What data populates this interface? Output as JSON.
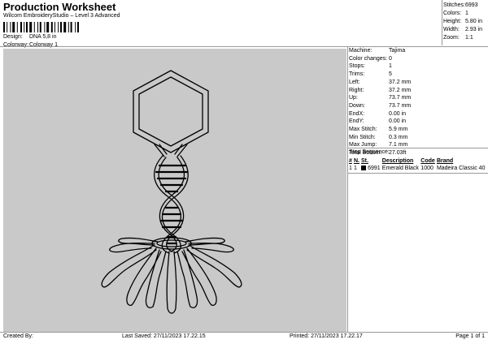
{
  "header": {
    "title": "Production Worksheet",
    "subtitle": "Wilcom EmbroideryStudio – Level 3 Advanced"
  },
  "design_info": {
    "design_label": "Design:",
    "design_value": "DNA 5,8 in",
    "colorway_label": "Colorway:",
    "colorway_value": "Colorway 1"
  },
  "stats": {
    "stitches_label": "Stitches:",
    "stitches": "6993",
    "colors_label": "Colors:",
    "colors": "1",
    "height_label": "Height:",
    "height": "5.80 in",
    "width_label": "Width:",
    "width": "2.93 in",
    "zoom_label": "Zoom:",
    "zoom": "1:1"
  },
  "machine_info": [
    {
      "label": "Machine:",
      "value": "Tajima"
    },
    {
      "label": "Color changes:",
      "value": "0"
    },
    {
      "label": "Stops:",
      "value": "1"
    },
    {
      "label": "Trims:",
      "value": "5"
    },
    {
      "label": "Left:",
      "value": "37.2 mm"
    },
    {
      "label": "Right:",
      "value": "37.2 mm"
    },
    {
      "label": "Up:",
      "value": "73.7 mm"
    },
    {
      "label": "Down:",
      "value": "73.7 mm"
    },
    {
      "label": "EndX:",
      "value": "0.00 in"
    },
    {
      "label": "EndY:",
      "value": "0.00 in"
    },
    {
      "label": "Max Stitch:",
      "value": "5.9 mm"
    },
    {
      "label": "Min Stitch:",
      "value": "0.3 mm"
    },
    {
      "label": "Max Jump:",
      "value": "7.1 mm"
    },
    {
      "label": "Total Bobbin:",
      "value": "27.03ft"
    }
  ],
  "stop_sequence": {
    "title": "Stop Sequence:",
    "headers": [
      "#",
      "N.",
      "St.",
      "Description",
      "Code",
      "Brand"
    ],
    "rows": [
      {
        "num": "1",
        "n": "1",
        "swatch_color": "#000000",
        "st": "6991",
        "description": "Emerald Black",
        "code": "1000",
        "brand": "Madeira Classic 40"
      }
    ]
  },
  "footer": {
    "created_by": "Created By:",
    "last_saved": "Last Saved: 27/11/2023 17.22.15",
    "printed": "Printed: 27/11/2023 17.22.17",
    "page": "Page 1 of 1"
  },
  "colors": {
    "canvas_bg": "#c9c9c9",
    "outline": "#000000",
    "rule": "#9a9a9a"
  },
  "icons": {
    "barcode": "barcode-icon",
    "design_preview": "dna-bacteriophage-embroidery-preview"
  }
}
